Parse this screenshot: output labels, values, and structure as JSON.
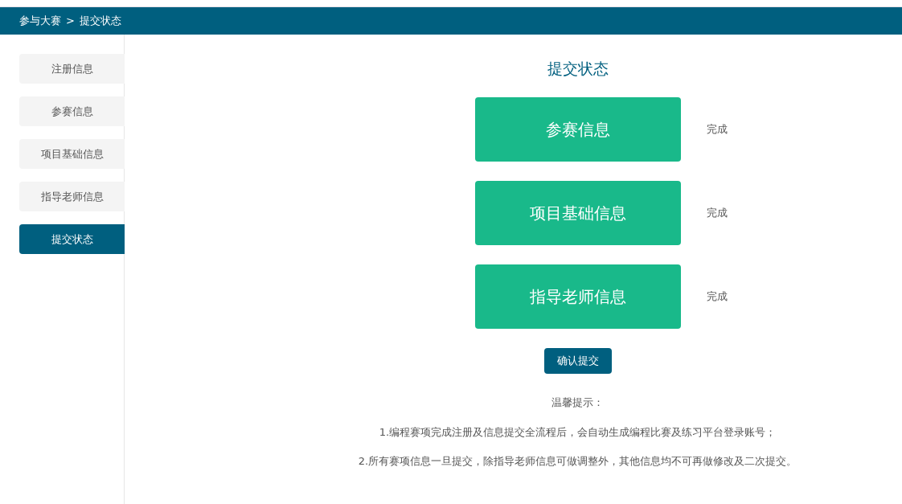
{
  "breadcrumb": {
    "parent": "参与大赛",
    "separator": ">",
    "current": "提交状态"
  },
  "sidebar": {
    "items": [
      {
        "label": "注册信息",
        "selected": false
      },
      {
        "label": "参赛信息",
        "selected": false
      },
      {
        "label": "项目基础信息",
        "selected": false
      },
      {
        "label": "指导老师信息",
        "selected": false
      },
      {
        "label": "提交状态",
        "selected": true
      }
    ]
  },
  "title": "提交状态",
  "sections": [
    {
      "label": "参赛信息",
      "status": "完成"
    },
    {
      "label": "项目基础信息",
      "status": "完成"
    },
    {
      "label": "指导老师信息",
      "status": "完成"
    }
  ],
  "submit_button": "确认提交",
  "tips": {
    "heading": "温馨提示：",
    "lines": [
      "1.编程赛项完成注册及信息提交全流程后，会自动生成编程比赛及练习平台登录账号；",
      "2.所有赛项信息一旦提交，除指导老师信息可做调整外，其他信息均不可再做修改及二次提交。"
    ]
  }
}
